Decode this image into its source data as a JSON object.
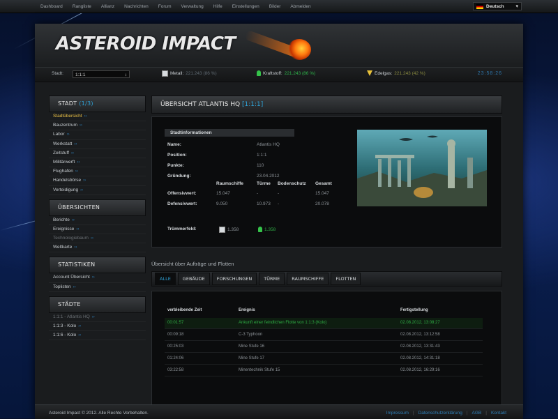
{
  "topnav": {
    "items": [
      "Dashboard",
      "Rangliste",
      "Allianz",
      "Nachrichten",
      "Forum",
      "Verwaltung",
      "Hilfe",
      "Einstellungen",
      "Bilder",
      "Abmelden"
    ]
  },
  "language": {
    "label": "Deutsch",
    "icon": "flag-germany-icon"
  },
  "header": {
    "logo": "ASTEROID IMPACT"
  },
  "resources": {
    "city_label": "Stadt:",
    "city_value": "1:1:1",
    "metal_label": "Metall:",
    "metal_value": "221.243 (86 %)",
    "fuel_label": "Kraftstoff:",
    "fuel_value": "221.243 (86 %)",
    "gas_label": "Edelgas:",
    "gas_value": "221.243 (42 %)",
    "clock": "23:58:26"
  },
  "sidebar": {
    "city_head": "Stadt",
    "city_count": "(1/3)",
    "city_items": [
      {
        "label": "Stadtübersicht",
        "state": "active"
      },
      {
        "label": "Bauzentrum",
        "state": ""
      },
      {
        "label": "Labor",
        "state": ""
      },
      {
        "label": "Werkstatt",
        "state": ""
      },
      {
        "label": "Zeitstuff",
        "state": ""
      },
      {
        "label": "Militärwerft",
        "state": ""
      },
      {
        "label": "Flughafen",
        "state": ""
      },
      {
        "label": "Handelsbörse",
        "state": ""
      },
      {
        "label": "Verteidigung",
        "state": ""
      }
    ],
    "overview_head": "Übersichten",
    "overview_items": [
      {
        "label": "Berichte",
        "state": ""
      },
      {
        "label": "Ereignisse",
        "state": ""
      },
      {
        "label": "Technologiebaum",
        "state": "dim"
      },
      {
        "label": "Weltkarte",
        "state": ""
      }
    ],
    "stats_head": "Statistiken",
    "stats_items": [
      {
        "label": "Account Übersicht",
        "state": ""
      },
      {
        "label": "Toplisten",
        "state": ""
      }
    ],
    "cities_head": "Städte",
    "cities_items": [
      {
        "label": "1:1:1 - Atlantis HQ",
        "state": "dim"
      },
      {
        "label": "1:1:3 - Kolo",
        "state": ""
      },
      {
        "label": "1:1:6 - Kolo",
        "state": ""
      }
    ]
  },
  "main": {
    "title": "Übersicht Atlantis HQ",
    "title_coords": "[1:1:1]",
    "info_head": "Stadtinformationen",
    "info": [
      {
        "k": "Name:",
        "v": "Atlantis HQ"
      },
      {
        "k": "Position:",
        "v": "1:1:1"
      },
      {
        "k": "Punkte:",
        "v": "110"
      },
      {
        "k": "Gründung:",
        "v": "23.04.2012"
      }
    ],
    "stats_cols": [
      "Raumschiffe",
      "Türme",
      "Bodenschutz",
      "Gesamt"
    ],
    "stats_rows": [
      {
        "label": "Offensivwert:",
        "values": [
          "15.047",
          "-",
          "-",
          "15.047"
        ]
      },
      {
        "label": "Defensivwert:",
        "values": [
          "9.050",
          "10.973",
          "-",
          "20.078"
        ]
      }
    ],
    "trumm_label": "Trümmerfeld:",
    "trumm_metal": "1.358",
    "trumm_fuel": "1.358",
    "queue_title": "Übersicht über Aufträge und Flotten",
    "tabs": [
      "Alle",
      "Gebäude",
      "Forschungen",
      "Türme",
      "Raumschiffe",
      "Flotten"
    ],
    "queue_headers": [
      "verbleibende Zeit",
      "Ereignis",
      "Fertigstellung"
    ],
    "queue_rows": [
      {
        "time": "00:01:57",
        "event": "Ankunft einer feindlichen Flotte von 1:1:3 (Kolo)",
        "done": "02.08.2012, 13:08:27",
        "hl": true
      },
      {
        "time": "00:09:18",
        "event": "C-3 Typhoon",
        "done": "02.08.2012, 13:12:58",
        "hl": false
      },
      {
        "time": "00:25:03",
        "event": "Mine Stufe 16",
        "done": "02.08.2012, 13:31:43",
        "hl": false
      },
      {
        "time": "01:24:06",
        "event": "Mine Stufe 17",
        "done": "02.08.2012, 14:31:18",
        "hl": false
      },
      {
        "time": "03:22:58",
        "event": "Minentechnik Stufe 15",
        "done": "02.08.2012, 16:29:16",
        "hl": false
      }
    ]
  },
  "footer": {
    "copyright": "Asteroid Impact © 2012. Alle Rechte Vorbehalten.",
    "links": [
      "Impressum",
      "Datenschutzerklärung",
      "AGB",
      "Kontakt"
    ]
  },
  "colors": {
    "accent": "#2fa3d8",
    "active": "#e9c046",
    "success": "#2fae45"
  }
}
